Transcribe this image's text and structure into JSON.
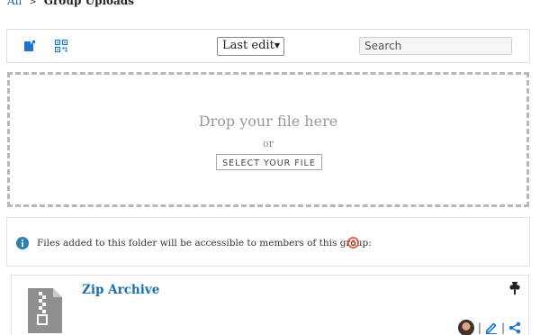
{
  "breadcrumb": {
    "root": "All",
    "separator": ">",
    "current": "Group Uploads"
  },
  "toolbar": {
    "upload_icon": "upload-icon",
    "qr_icon": "qr-code-icon",
    "sort": {
      "selected": "Last edit"
    },
    "search": {
      "placeholder": "Search"
    }
  },
  "dropzone": {
    "title": "Drop your file here",
    "or": "or",
    "select_label": "SELECT YOUR FILE"
  },
  "info": {
    "text": "Files added to this folder will be accessible to members of this group:",
    "icon": "info-icon",
    "group_icon": "group-icon"
  },
  "file": {
    "name": "Zip Archive",
    "icon": "zip-file-icon",
    "pin_icon": "pin-icon",
    "actions": [
      "avatar",
      "edit-icon",
      "share-icon"
    ]
  },
  "colors": {
    "link": "#1a6fb0",
    "accent": "#1976d2",
    "group": "#e0533d"
  }
}
